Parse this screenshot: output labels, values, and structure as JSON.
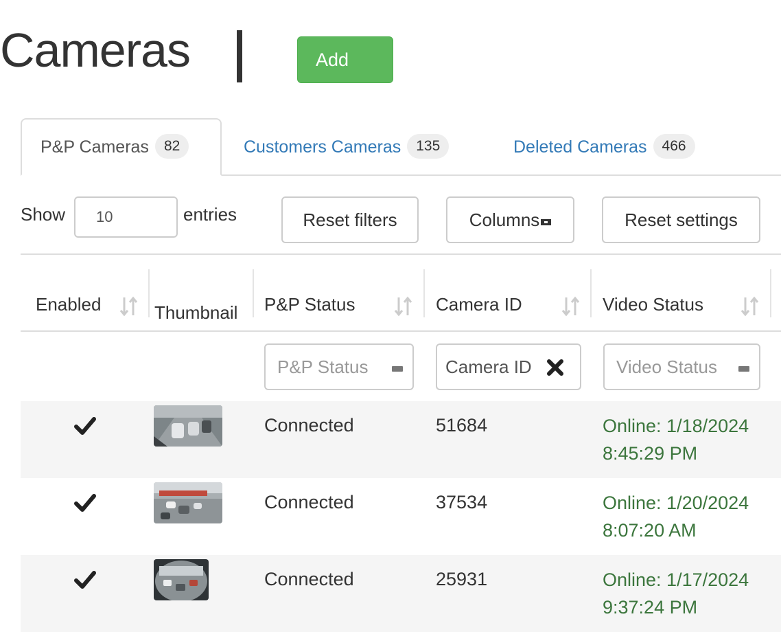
{
  "header": {
    "title": "Cameras",
    "add_label": "Add"
  },
  "tabs": [
    {
      "label": "P&P Cameras",
      "count": "82",
      "active": true
    },
    {
      "label": "Customers Cameras",
      "count": "135",
      "active": false
    },
    {
      "label": "Deleted Cameras",
      "count": "466",
      "active": false
    }
  ],
  "controls": {
    "show_label": "Show",
    "entries_value": "10",
    "entries_label": "entries",
    "reset_filters": "Reset filters",
    "columns": "Columns",
    "reset_settings": "Reset settings"
  },
  "table": {
    "columns": [
      "Enabled",
      "Thumbnail",
      "P&P Status",
      "Camera ID",
      "Video Status"
    ],
    "filters": {
      "pp_status_placeholder": "P&P Status",
      "camera_id_value": "Camera ID",
      "video_status_placeholder": "Video Status"
    },
    "rows": [
      {
        "enabled": true,
        "pp_status": "Connected",
        "camera_id": "51684",
        "video_status_line1": "Online: 1/18/2024",
        "video_status_line2": "8:45:29 PM"
      },
      {
        "enabled": true,
        "pp_status": "Connected",
        "camera_id": "37534",
        "video_status_line1": "Online: 1/20/2024",
        "video_status_line2": "8:07:20 AM"
      },
      {
        "enabled": true,
        "pp_status": "Connected",
        "camera_id": "25931",
        "video_status_line1": "Online: 1/17/2024",
        "video_status_line2": "9:37:24 PM"
      }
    ]
  },
  "colors": {
    "add_button": "#5cb85c",
    "link": "#337ab7",
    "online_status": "#3c763d"
  },
  "icons": [
    "checkmark-icon",
    "sort-icon",
    "clear-icon",
    "dropdown-icon"
  ]
}
